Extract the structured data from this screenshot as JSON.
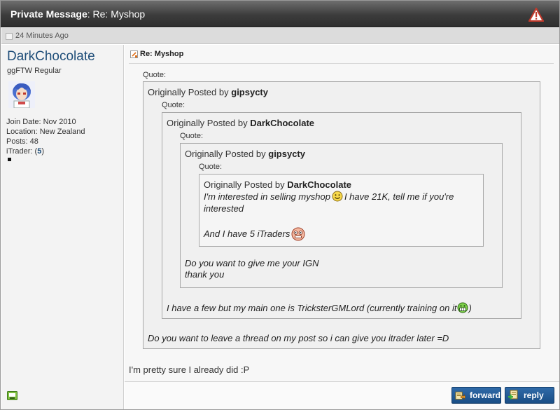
{
  "window": {
    "title_bold": "Private Message",
    "title_rest": ": Re: Myshop"
  },
  "post": {
    "date": "24 Minutes Ago",
    "title": "Re: Myshop",
    "reply_text": "I'm pretty sure I already did :P"
  },
  "user": {
    "name": "DarkChocolate",
    "title": "ggFTW Regular",
    "join_date": "Join Date: Nov 2010",
    "location": "Location: New Zealand",
    "posts": "Posts: 48",
    "itrader_label": "iTrader: (",
    "itrader_value": "5",
    "itrader_close": ")"
  },
  "quotes": {
    "label": "Quote:",
    "originally_posted_by": "Originally Posted by",
    "q1_author": "gipsycty",
    "q2_author": "DarkChocolate",
    "q3_author": "gipsycty",
    "q4_author": "DarkChocolate",
    "q4_line1a": "I'm interested in selling myshop",
    "q4_line1b": "I have 21K, tell me if you're",
    "q4_line2": "interested",
    "q4_line3": "And I have 5 iTraders",
    "q3_line1": "Do you want to give me your IGN",
    "q3_line2": "thank you",
    "q2_line1": "I have a few but my main one is TricksterGMLord (currently training on it",
    "q2_line1_end": ")",
    "q1_line1": "Do you want to leave a thread on my post so i can give you itrader later =D"
  },
  "buttons": {
    "forward": "forward",
    "reply": "reply"
  },
  "icons": {
    "warning": "warning-triangle-icon",
    "post": "post-icon",
    "title": "message-title-icon",
    "smile": "smile-icon",
    "shocked": "shocked-icon",
    "grin": "grin-icon",
    "forward": "forward-icon",
    "reply": "reply-icon",
    "status": "online-status-icon"
  },
  "colors": {
    "username": "#1f4e79",
    "button": "#1a4e86",
    "titlebar": "#3c3c3c"
  }
}
